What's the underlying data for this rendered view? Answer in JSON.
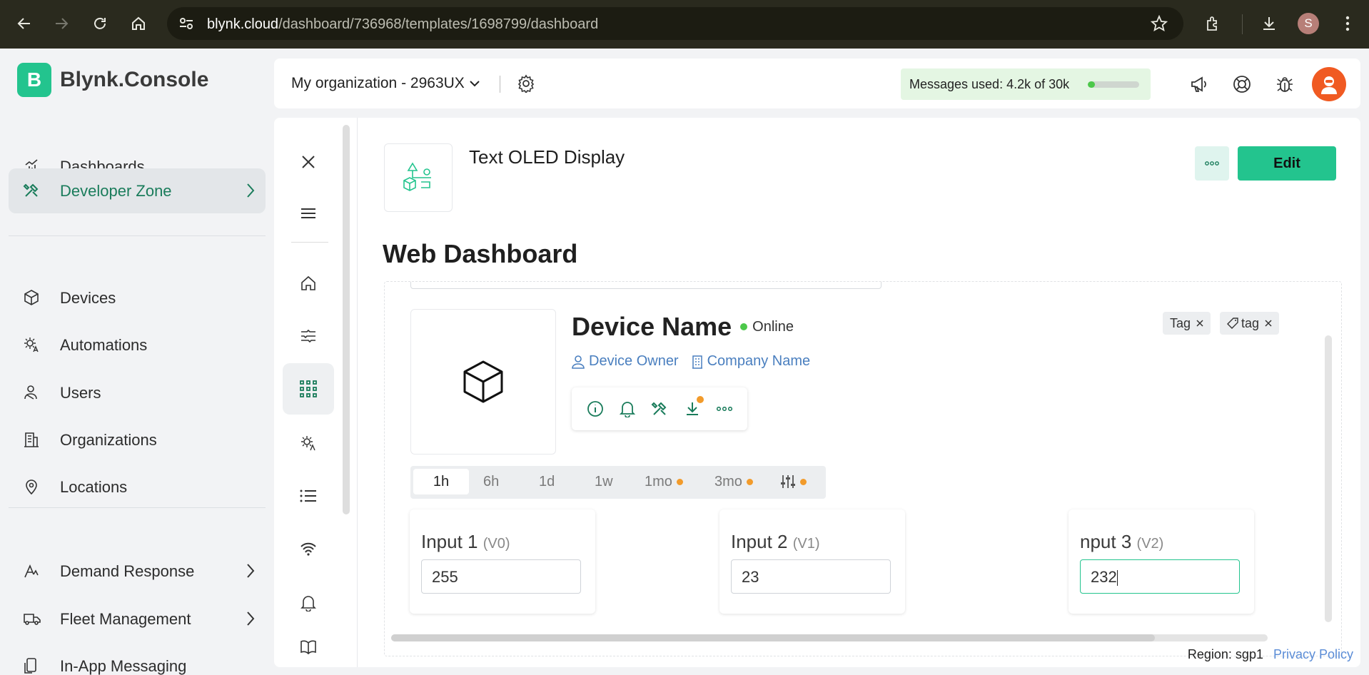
{
  "browser": {
    "url_host": "blynk.cloud",
    "url_path": "/dashboard/736968/templates/1698799/dashboard",
    "profile_initial": "S"
  },
  "brand": {
    "logo_letter": "B",
    "name": "Blynk.Console",
    "accent": "#23c48e"
  },
  "sidebar": {
    "items": [
      {
        "label": "Dashboards",
        "icon": "bar-chart-icon"
      },
      {
        "label": "Developer Zone",
        "icon": "tools-icon",
        "active": true
      },
      {
        "label": "Devices",
        "icon": "cube-icon"
      },
      {
        "label": "Automations",
        "icon": "automation-icon"
      },
      {
        "label": "Users",
        "icon": "users-icon"
      },
      {
        "label": "Organizations",
        "icon": "building-icon"
      },
      {
        "label": "Locations",
        "icon": "pin-icon"
      },
      {
        "label": "Demand Response",
        "icon": "demand-icon"
      },
      {
        "label": "Fleet Management",
        "icon": "truck-icon"
      },
      {
        "label": "In-App Messaging",
        "icon": "message-icon"
      }
    ]
  },
  "topbar": {
    "org": "My organization - 2963UX",
    "messages_label": "Messages used:",
    "messages_value": "4.2k of 30k",
    "messages_fraction": 0.14
  },
  "template": {
    "title": "Text OLED Display",
    "edit_label": "Edit",
    "section_title": "Web Dashboard"
  },
  "device": {
    "name": "Device Name",
    "status": "Online",
    "owner": "Device Owner",
    "company": "Company Name",
    "tags": [
      "Tag",
      "tag"
    ]
  },
  "time_tabs": [
    "1h",
    "6h",
    "1d",
    "1w",
    "1mo",
    "3mo"
  ],
  "inputs": [
    {
      "label": "Input 1",
      "pin": "(V0)",
      "value": "255"
    },
    {
      "label": "Input 2",
      "pin": "(V1)",
      "value": "23"
    },
    {
      "label": "nput 3",
      "pin": "(V2)",
      "value": "232"
    }
  ],
  "footer": {
    "region": "Region: sgp1",
    "privacy": "Privacy Policy"
  }
}
